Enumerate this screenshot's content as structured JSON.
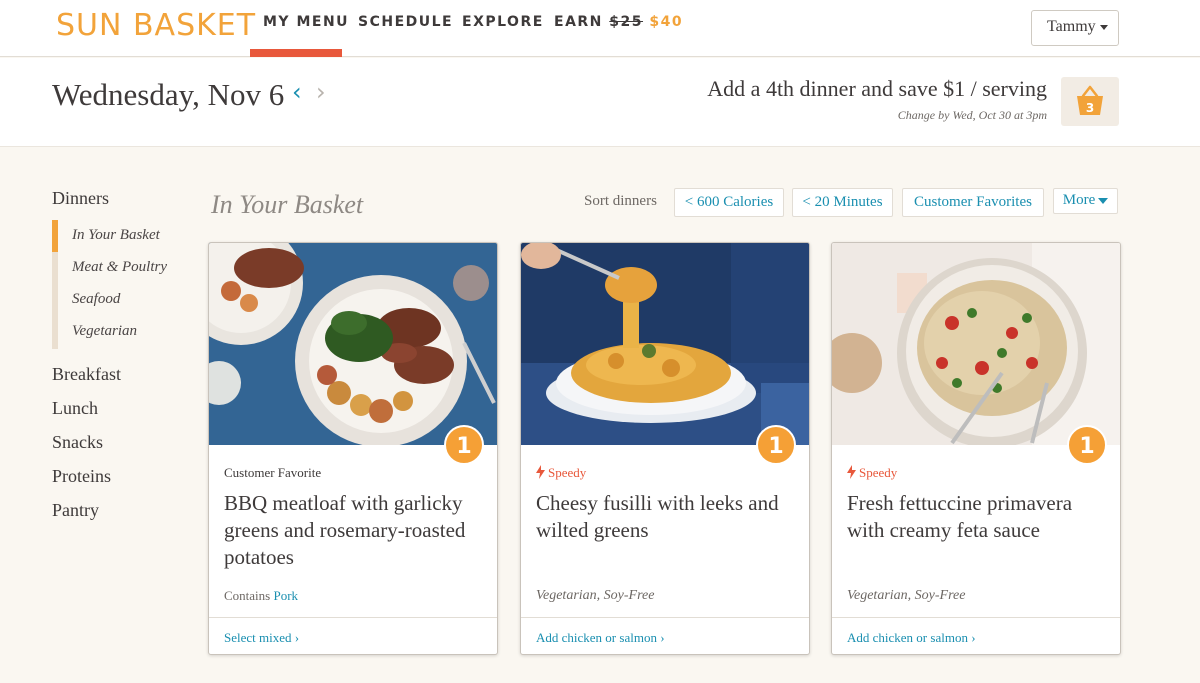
{
  "brand": {
    "logo_text": "SUN BASKET",
    "accent": "#f2a33a",
    "link_color": "#1a8fb0",
    "badge_color": "#f5a036"
  },
  "nav": {
    "items": [
      "MY MENU",
      "SCHEDULE",
      "EXPLORE"
    ],
    "earn_label": "EARN",
    "earn_old": "$25",
    "earn_new": "$40",
    "user": "Tammy"
  },
  "header": {
    "date": "Wednesday, Nov 6",
    "prev_icon": "chevron-left-icon",
    "next_icon": "chevron-right-icon",
    "promo": "Add a 4th dinner and save $1 / serving",
    "promo_sub": "Change by Wed, Oct 30 at 3pm",
    "basket_count": "3"
  },
  "sidebar": {
    "dinners": "Dinners",
    "dinner_subs": [
      "In Your Basket",
      "Meat & Poultry",
      "Seafood",
      "Vegetarian"
    ],
    "categories": [
      "Breakfast",
      "Lunch",
      "Snacks",
      "Proteins",
      "Pantry"
    ]
  },
  "basket": {
    "title": "In Your Basket",
    "sort_label": "Sort dinners",
    "sort_options": [
      "< 600 Calories",
      "< 20 Minutes",
      "Customer Favorites"
    ],
    "more_label": "More"
  },
  "cards": [
    {
      "tag": "Customer Favorite",
      "title": "BBQ meatloaf with garlicky greens and rosemary-roasted potatoes",
      "meta_prefix": "Contains",
      "meta_link": "Pork",
      "qty": "1",
      "footer": "Select mixed ›"
    },
    {
      "tag": "Speedy",
      "title": "Cheesy fusilli with leeks and wilted greens",
      "meta": "Vegetarian, Soy-Free",
      "qty": "1",
      "footer": "Add chicken or salmon ›"
    },
    {
      "tag": "Speedy",
      "title": "Fresh fettuccine primavera with creamy feta sauce",
      "meta": "Vegetarian, Soy-Free",
      "qty": "1",
      "footer": "Add chicken or salmon ›"
    }
  ]
}
